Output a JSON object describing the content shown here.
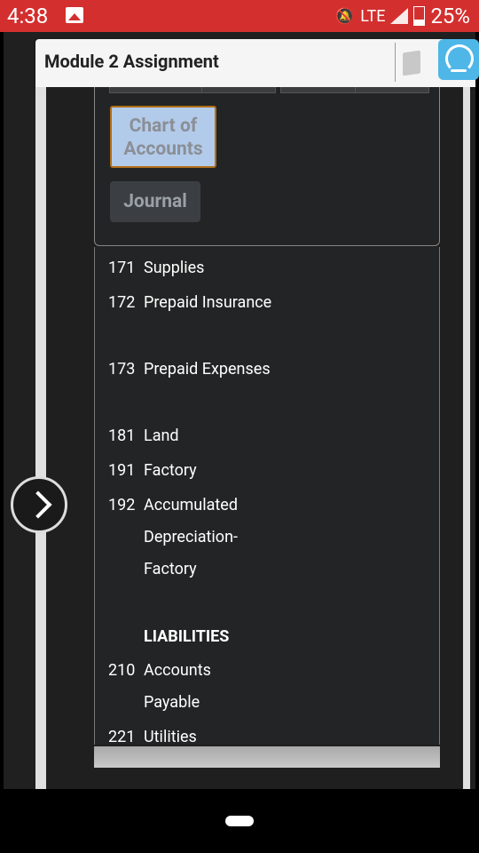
{
  "status_bar": {
    "time": "4:38",
    "network": "LTE",
    "battery": "25%"
  },
  "modal": {
    "title": "Module 2 Assignment"
  },
  "tool_buttons": {
    "chart_of_accounts": "Chart of Accounts",
    "journal": "Journal"
  },
  "accounts": [
    {
      "number": "171",
      "name": "Supplies"
    },
    {
      "number": "172",
      "name": "Prepaid Insurance"
    },
    {
      "number": "173",
      "name": "Prepaid Expenses"
    },
    {
      "number": "181",
      "name": "Land"
    },
    {
      "number": "191",
      "name": "Factory"
    },
    {
      "number": "192",
      "name": "Accumulated Depreciation-Factory"
    }
  ],
  "liabilities_heading": "LIABILITIES",
  "liabilities": [
    {
      "number": "210",
      "name": "Accounts Payable"
    },
    {
      "number": "221",
      "name": "Utilities"
    }
  ],
  "colors": {
    "status_bar": "#d32f2f",
    "chart_btn_bg": "#b3cbea",
    "chart_btn_border": "#b06e1a",
    "panel_bg": "#232425",
    "support_btn": "#4fb6e8"
  }
}
